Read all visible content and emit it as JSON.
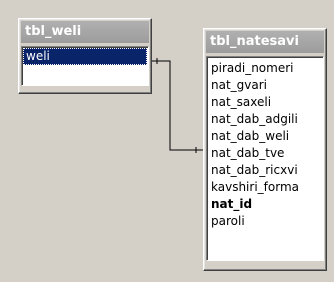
{
  "tables": [
    {
      "id": "weli",
      "title": "tbl_weli",
      "fields": [
        {
          "label": "weli",
          "selected": true,
          "primary_key": false
        }
      ]
    },
    {
      "id": "nat",
      "title": "tbl_natesavi",
      "fields": [
        {
          "label": "piradi_nomeri",
          "selected": false,
          "primary_key": false
        },
        {
          "label": "nat_gvari",
          "selected": false,
          "primary_key": false
        },
        {
          "label": "nat_saxeli",
          "selected": false,
          "primary_key": false
        },
        {
          "label": "nat_dab_adgili",
          "selected": false,
          "primary_key": false
        },
        {
          "label": "nat_dab_weli",
          "selected": false,
          "primary_key": false
        },
        {
          "label": "nat_dab_tve",
          "selected": false,
          "primary_key": false
        },
        {
          "label": "nat_dab_ricxvi",
          "selected": false,
          "primary_key": false
        },
        {
          "label": "kavshiri_forma",
          "selected": false,
          "primary_key": false
        },
        {
          "label": "nat_id",
          "selected": false,
          "primary_key": true
        },
        {
          "label": "paroli",
          "selected": false,
          "primary_key": false
        }
      ]
    }
  ],
  "relationship": {
    "from": "tbl_weli.weli",
    "to": "tbl_natesavi.nat_dab_weli"
  },
  "colors": {
    "background": "#d4d0c8",
    "titlebar": "#a8a8a8",
    "selection": "#0a246a",
    "line": "#000000"
  }
}
